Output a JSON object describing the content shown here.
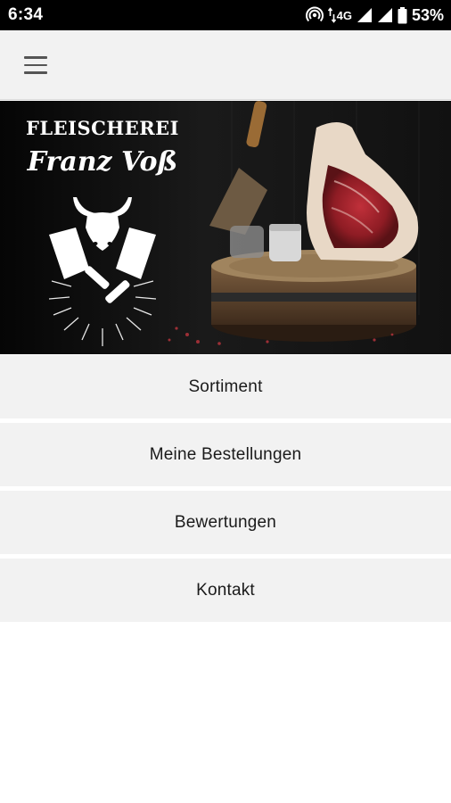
{
  "status_bar": {
    "time": "6:34",
    "network": "4G",
    "battery": "53%",
    "icons": [
      "hotspot-icon",
      "data-transfer-icon",
      "signal-icon",
      "signal-icon",
      "battery-icon"
    ]
  },
  "toolbar": {
    "menu_icon": "hamburger-menu-icon"
  },
  "hero": {
    "logo_line1": "FLEISCHEREI",
    "logo_line2": "Franz Voß",
    "logo_icons": [
      "bull-head-icon",
      "cleaver-icon",
      "cleaver-icon"
    ]
  },
  "menu": {
    "items": [
      {
        "label": "Sortiment"
      },
      {
        "label": "Meine Bestellungen"
      },
      {
        "label": "Bewertungen"
      },
      {
        "label": "Kontakt"
      }
    ]
  },
  "colors": {
    "status_bar": "#000000",
    "toolbar": "#f2f2f2",
    "menu_item_bg": "#f2f2f2",
    "text": "#1a1a1a"
  }
}
